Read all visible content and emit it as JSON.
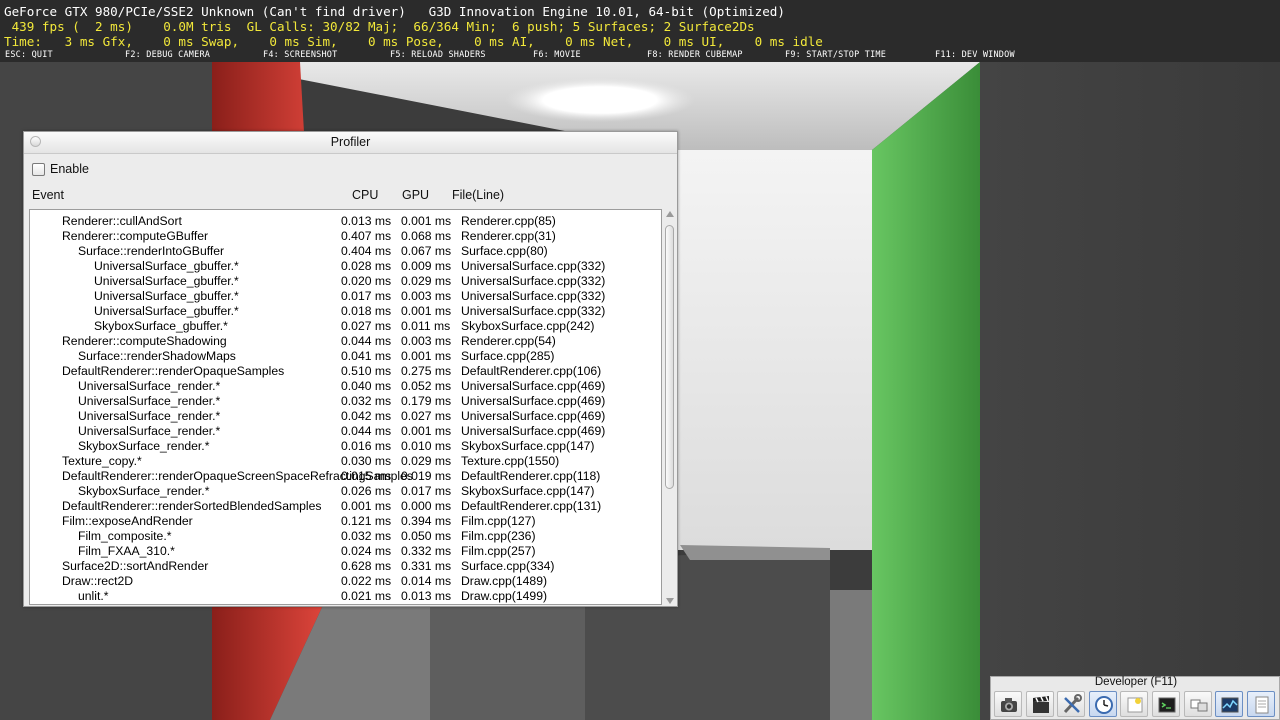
{
  "hud": {
    "line1": "GeForce GTX 980/PCIe/SSE2 Unknown (Can't find driver)   G3D Innovation Engine 10.01, 64-bit (Optimized)",
    "line2": " 439 fps (  2 ms)    0.0M tris  GL Calls: 30/82 Maj;  66/364 Min;  6 push; 5 Surfaces; 2 Surface2Ds",
    "line3": "Time:   3 ms Gfx,    0 ms Swap,    0 ms Sim,    0 ms Pose,    0 ms AI,    0 ms Net,    0 ms UI,    0 ms idle",
    "keys": [
      "ESC: QUIT",
      "F2: DEBUG CAMERA",
      "F4: SCREENSHOT",
      "F5: RELOAD SHADERS",
      "F6: MOVIE",
      "F8: RENDER CUBEMAP",
      "F9: START/STOP TIME",
      "F11: DEV WINDOW"
    ],
    "text_color": "#ffffff",
    "stats_color": "#f2e83a"
  },
  "profiler": {
    "title": "Profiler",
    "enable_label": "Enable",
    "enable_checked": false,
    "headers": {
      "event": "Event",
      "cpu": "CPU",
      "gpu": "GPU",
      "file": "File(Line)"
    },
    "rows": [
      {
        "event": "Renderer::cullAndSort",
        "depth": 1,
        "cpu": "0.013 ms",
        "gpu": "0.001 ms",
        "file": "Renderer.cpp(85)"
      },
      {
        "event": "Renderer::computeGBuffer",
        "depth": 1,
        "cpu": "0.407 ms",
        "gpu": "0.068 ms",
        "file": "Renderer.cpp(31)"
      },
      {
        "event": "Surface::renderIntoGBuffer",
        "depth": 2,
        "cpu": "0.404 ms",
        "gpu": "0.067 ms",
        "file": "Surface.cpp(80)"
      },
      {
        "event": "UniversalSurface_gbuffer.*",
        "depth": 3,
        "cpu": "0.028 ms",
        "gpu": "0.009 ms",
        "file": "UniversalSurface.cpp(332)"
      },
      {
        "event": "UniversalSurface_gbuffer.*",
        "depth": 3,
        "cpu": "0.020 ms",
        "gpu": "0.029 ms",
        "file": "UniversalSurface.cpp(332)"
      },
      {
        "event": "UniversalSurface_gbuffer.*",
        "depth": 3,
        "cpu": "0.017 ms",
        "gpu": "0.003 ms",
        "file": "UniversalSurface.cpp(332)"
      },
      {
        "event": "UniversalSurface_gbuffer.*",
        "depth": 3,
        "cpu": "0.018 ms",
        "gpu": "0.001 ms",
        "file": "UniversalSurface.cpp(332)"
      },
      {
        "event": "SkyboxSurface_gbuffer.*",
        "depth": 3,
        "cpu": "0.027 ms",
        "gpu": "0.011 ms",
        "file": "SkyboxSurface.cpp(242)"
      },
      {
        "event": "Renderer::computeShadowing",
        "depth": 1,
        "cpu": "0.044 ms",
        "gpu": "0.003 ms",
        "file": "Renderer.cpp(54)"
      },
      {
        "event": "Surface::renderShadowMaps",
        "depth": 2,
        "cpu": "0.041 ms",
        "gpu": "0.001 ms",
        "file": "Surface.cpp(285)"
      },
      {
        "event": "DefaultRenderer::renderOpaqueSamples",
        "depth": 1,
        "cpu": "0.510 ms",
        "gpu": "0.275 ms",
        "file": "DefaultRenderer.cpp(106)"
      },
      {
        "event": "UniversalSurface_render.*",
        "depth": 2,
        "cpu": "0.040 ms",
        "gpu": "0.052 ms",
        "file": "UniversalSurface.cpp(469)"
      },
      {
        "event": "UniversalSurface_render.*",
        "depth": 2,
        "cpu": "0.032 ms",
        "gpu": "0.179 ms",
        "file": "UniversalSurface.cpp(469)"
      },
      {
        "event": "UniversalSurface_render.*",
        "depth": 2,
        "cpu": "0.042 ms",
        "gpu": "0.027 ms",
        "file": "UniversalSurface.cpp(469)"
      },
      {
        "event": "UniversalSurface_render.*",
        "depth": 2,
        "cpu": "0.044 ms",
        "gpu": "0.001 ms",
        "file": "UniversalSurface.cpp(469)"
      },
      {
        "event": "SkyboxSurface_render.*",
        "depth": 2,
        "cpu": "0.016 ms",
        "gpu": "0.010 ms",
        "file": "SkyboxSurface.cpp(147)"
      },
      {
        "event": "Texture_copy.*",
        "depth": 1,
        "cpu": "0.030 ms",
        "gpu": "0.029 ms",
        "file": "Texture.cpp(1550)"
      },
      {
        "event": "DefaultRenderer::renderOpaqueScreenSpaceRefractingSamples",
        "depth": 1,
        "cpu": "0.015 ms",
        "gpu": "0.019 ms",
        "file": "DefaultRenderer.cpp(118)"
      },
      {
        "event": "SkyboxSurface_render.*",
        "depth": 2,
        "cpu": "0.026 ms",
        "gpu": "0.017 ms",
        "file": "SkyboxSurface.cpp(147)"
      },
      {
        "event": "DefaultRenderer::renderSortedBlendedSamples",
        "depth": 1,
        "cpu": "0.001 ms",
        "gpu": "0.000 ms",
        "file": "DefaultRenderer.cpp(131)"
      },
      {
        "event": "Film::exposeAndRender",
        "depth": 1,
        "cpu": "0.121 ms",
        "gpu": "0.394 ms",
        "file": "Film.cpp(127)"
      },
      {
        "event": "Film_composite.*",
        "depth": 2,
        "cpu": "0.032 ms",
        "gpu": "0.050 ms",
        "file": "Film.cpp(236)"
      },
      {
        "event": "Film_FXAA_310.*",
        "depth": 2,
        "cpu": "0.024 ms",
        "gpu": "0.332 ms",
        "file": "Film.cpp(257)"
      },
      {
        "event": "Surface2D::sortAndRender",
        "depth": 1,
        "cpu": "0.628 ms",
        "gpu": "0.331 ms",
        "file": "Surface.cpp(334)"
      },
      {
        "event": "Draw::rect2D",
        "depth": 1,
        "cpu": "0.022 ms",
        "gpu": "0.014 ms",
        "file": "Draw.cpp(1489)"
      },
      {
        "event": "unlit.*",
        "depth": 2,
        "cpu": "0.021 ms",
        "gpu": "0.013 ms",
        "file": "Draw.cpp(1499)"
      }
    ]
  },
  "developer": {
    "title": "Developer (F11)",
    "buttons": [
      {
        "icon": "camera-icon",
        "active": false
      },
      {
        "icon": "clapperboard-icon",
        "active": false
      },
      {
        "icon": "tools-icon",
        "active": false
      },
      {
        "icon": "clock-icon",
        "active": true
      },
      {
        "icon": "light-icon",
        "active": false
      },
      {
        "icon": "terminal-icon",
        "active": false
      },
      {
        "icon": "windows-icon",
        "active": false
      },
      {
        "icon": "profiler-icon",
        "active": true
      },
      {
        "icon": "document-icon",
        "active": true
      }
    ]
  },
  "colors": {
    "red_wall": "#d9473c",
    "green_wall": "#3f9a3f",
    "active_button": "#c8d8ef"
  }
}
